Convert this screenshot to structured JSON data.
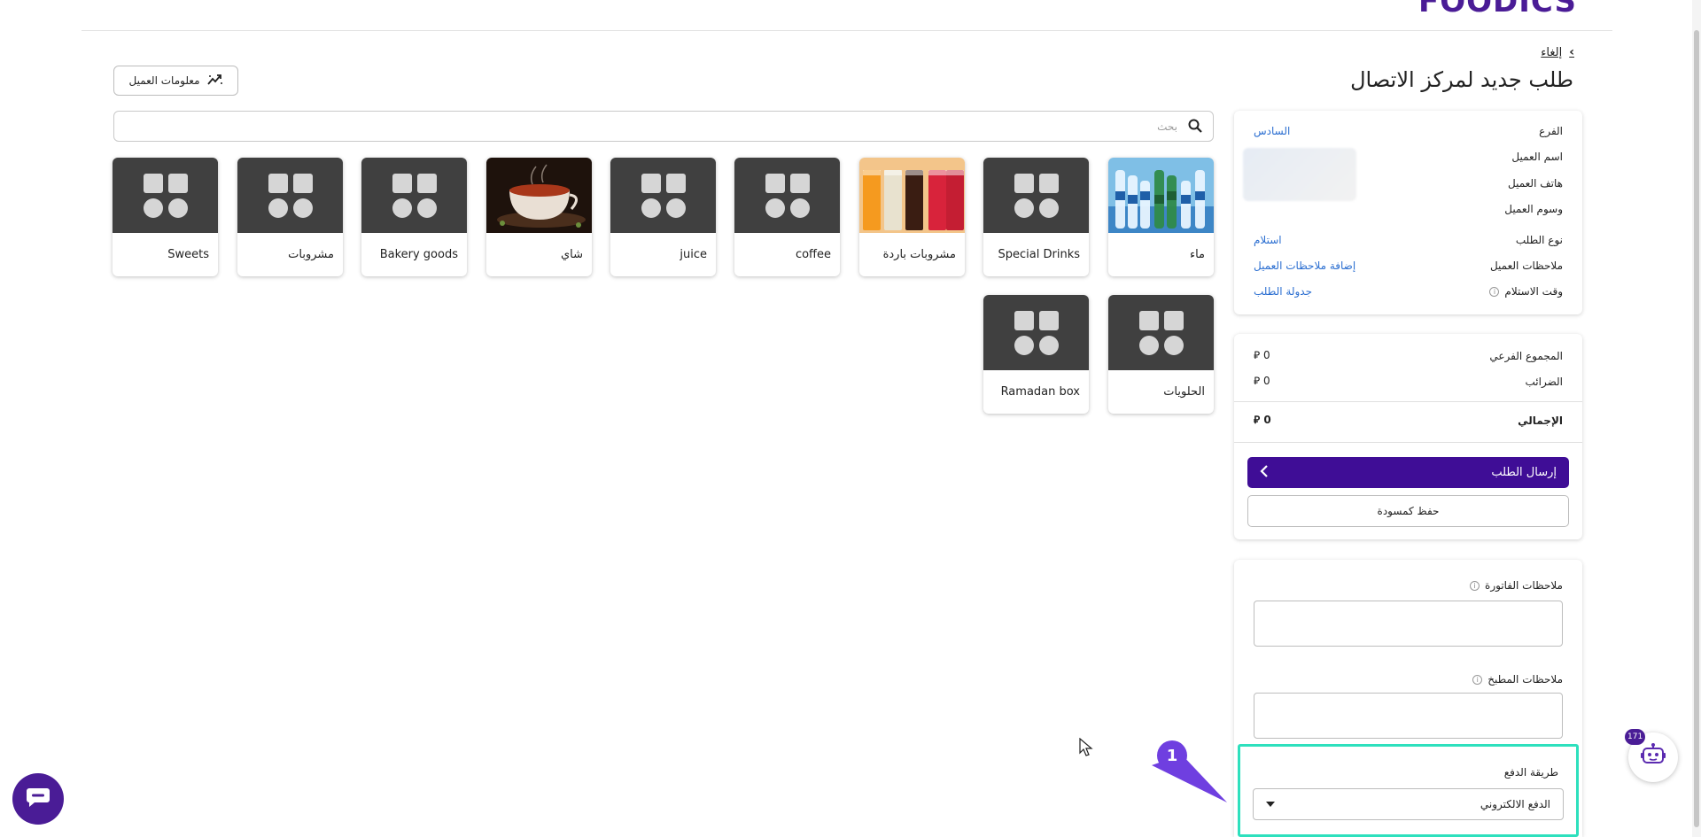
{
  "header": {
    "logo_text": "FOODICS"
  },
  "breadcrumb": {
    "cancel_label": "إلغاء"
  },
  "page": {
    "title": "طلب جديد لمركز الاتصال"
  },
  "toolbar": {
    "client_info_label": "معلومات العميل"
  },
  "search": {
    "placeholder": "بحث"
  },
  "categories": [
    {
      "label": "ماء",
      "image": "water"
    },
    {
      "label": "Special Drinks",
      "image": "placeholder"
    },
    {
      "label": "مشروبات باردة",
      "image": "cold-drinks"
    },
    {
      "label": "coffee",
      "image": "placeholder"
    },
    {
      "label": "juice",
      "image": "placeholder"
    },
    {
      "label": "شاي",
      "image": "tea"
    },
    {
      "label": "Bakery goods",
      "image": "placeholder"
    },
    {
      "label": "مشروبات",
      "image": "placeholder"
    },
    {
      "label": "Sweets",
      "image": "placeholder"
    },
    {
      "label": "الحلويات",
      "image": "placeholder"
    },
    {
      "label": "Ramadan box",
      "image": "placeholder"
    }
  ],
  "order_info": {
    "branch_label": "الفرع",
    "branch_value": "السادس",
    "customer_name_label": "اسم العميل",
    "customer_phone_label": "هاتف العميل",
    "customer_tags_label": "وسوم العميل",
    "order_type_label": "نوع الطلب",
    "order_type_value": "استلام",
    "customer_notes_label": "ملاحظات العميل",
    "customer_notes_action": "إضافة ملاحظات العميل",
    "pickup_time_label": "وقت الاستلام",
    "pickup_time_action": "جدولة الطلب"
  },
  "totals": {
    "subtotal_label": "المجموع الفرعي",
    "subtotal_value": "0",
    "taxes_label": "الضرائب",
    "taxes_value": "0",
    "total_label": "الإجمالي",
    "total_value": "0",
    "currency_symbol": "⃁"
  },
  "actions": {
    "submit_label": "إرسال الطلب",
    "draft_label": "حفظ كمسودة"
  },
  "notes": {
    "invoice_notes_label": "ملاحظات الفاتورة",
    "kitchen_notes_label": "ملاحظات المطبخ"
  },
  "payment": {
    "label": "طريقة الدفع",
    "selected": "الدفع الالكتروني"
  },
  "annotation": {
    "step_number": "1",
    "highlight_color": "#2de0bd"
  },
  "widgets": {
    "bot_badge_count": "171"
  },
  "colors": {
    "brand": "#4a1c96",
    "primary_button": "#3f0d96",
    "link": "#2c6fd1"
  }
}
